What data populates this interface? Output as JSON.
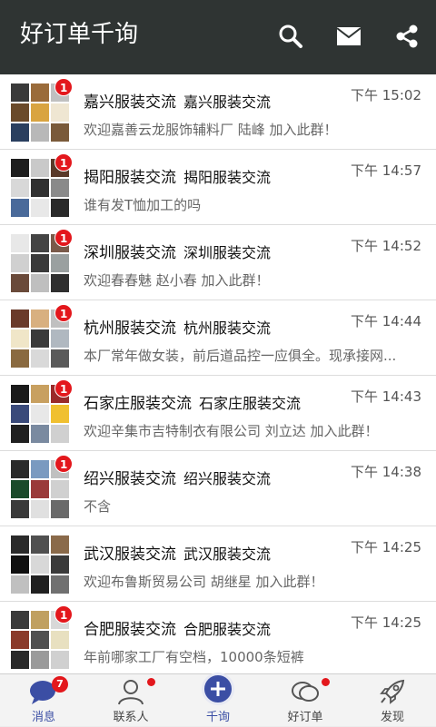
{
  "app": {
    "title": "好订单千询"
  },
  "colors": {
    "appbar": "#2f3433",
    "accent": "#3b4ea4",
    "badge": "#e3171c"
  },
  "header_actions": [
    {
      "icon": "search-icon"
    },
    {
      "icon": "mail-icon"
    },
    {
      "icon": "share-icon"
    }
  ],
  "conversations": [
    {
      "name": "嘉兴服装交流",
      "sub": "嘉兴服装交流",
      "time": "下午 15:02",
      "message": "欢迎嘉善云龙服饰辅料厂 陆峰 加入此群！",
      "badge": "1"
    },
    {
      "name": "揭阳服装交流",
      "sub": "揭阳服装交流",
      "time": "下午 14:57",
      "message": "谁有发T恤加工的吗",
      "badge": "1"
    },
    {
      "name": "深圳服装交流",
      "sub": "深圳服装交流",
      "time": "下午 14:52",
      "message": "欢迎春春魅 赵小春 加入此群！",
      "badge": "1"
    },
    {
      "name": "杭州服装交流",
      "sub": "杭州服装交流",
      "time": "下午 14:44",
      "message": "本厂常年做女装，前后道品控一应俱全。现承接网...",
      "badge": "1"
    },
    {
      "name": "石家庄服装交流",
      "sub": "石家庄服装交流",
      "time": "下午 14:43",
      "message": "欢迎辛集市吉特制衣有限公司 刘立达 加入此群！",
      "badge": "1"
    },
    {
      "name": "绍兴服装交流",
      "sub": "绍兴服装交流",
      "time": "下午 14:38",
      "message": "不含",
      "badge": "1"
    },
    {
      "name": "武汉服装交流",
      "sub": "武汉服装交流",
      "time": "下午 14:25",
      "message": "欢迎布鲁斯贸易公司 胡继星 加入此群！",
      "badge": ""
    },
    {
      "name": "合肥服装交流",
      "sub": "合肥服装交流",
      "time": "下午 14:25",
      "message": "年前哪家工厂有空档，10000条短裤",
      "badge": "1"
    }
  ],
  "tabs": [
    {
      "label": "消息",
      "icon": "chat-bubble-icon",
      "badge": "7"
    },
    {
      "label": "联系人",
      "icon": "contact-person-icon",
      "dot": true
    },
    {
      "label": "千询",
      "icon": "plus-icon"
    },
    {
      "label": "好订单",
      "icon": "speech-bubbles-icon",
      "dot": true
    },
    {
      "label": "发现",
      "icon": "rocket-icon"
    }
  ]
}
